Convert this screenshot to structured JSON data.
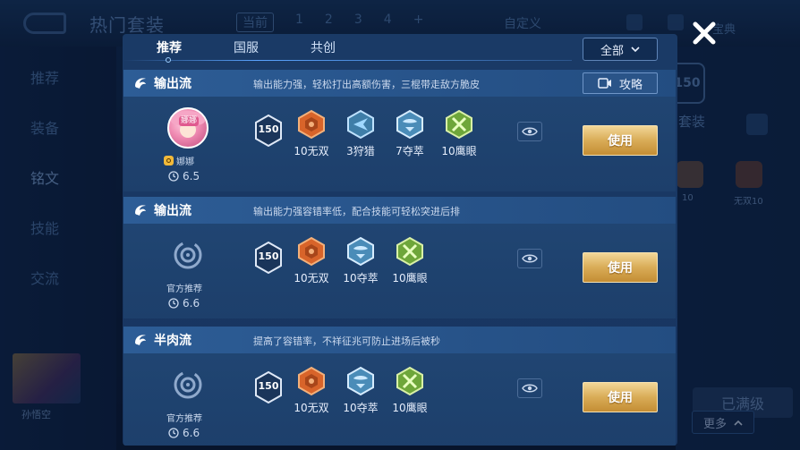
{
  "background": {
    "page_title": "热门套装",
    "top_tabs": [
      "当前",
      "1",
      "2",
      "3",
      "4",
      "+"
    ],
    "custom_label": "自定义",
    "fav_label": "宝典",
    "sidebar": [
      "推荐",
      "装备",
      "铭文",
      "技能",
      "交流"
    ],
    "hero_name": "孙悟空",
    "right_panel": {
      "level": "150",
      "title": "热门套装",
      "rune_labels": [
        "10",
        "无双10"
      ],
      "full_label": "已满级",
      "more_label": "更多"
    }
  },
  "modal": {
    "tabs": [
      "推荐",
      "国服",
      "共创"
    ],
    "active_tab": "推荐",
    "filter_label": "全部",
    "cards": [
      {
        "style": "输出流",
        "desc": "输出能力强，轻松打出高额伤害，三棍带走敌方脆皮",
        "guide_label": "攻略",
        "author": {
          "type": "player",
          "name": "娜娜",
          "avatar_badge": "娜娜",
          "rating": "6.5"
        },
        "level": "150",
        "runes": [
          {
            "label": "10无双",
            "color": "red"
          },
          {
            "label": "3狩猎",
            "color": "blue"
          },
          {
            "label": "7夺萃",
            "color": "blue"
          },
          {
            "label": "10鹰眼",
            "color": "green"
          }
        ],
        "use_label": "使用"
      },
      {
        "style": "输出流",
        "desc": "输出能力强容错率低，配合技能可轻松突进后排",
        "author": {
          "type": "official",
          "name": "官方推荐",
          "rating": "6.6"
        },
        "level": "150",
        "runes": [
          {
            "label": "10无双",
            "color": "red"
          },
          {
            "label": "10夺萃",
            "color": "blue"
          },
          {
            "label": "10鹰眼",
            "color": "green"
          }
        ],
        "use_label": "使用"
      },
      {
        "style": "半肉流",
        "desc": "提高了容错率，不祥征兆可防止进场后被秒",
        "author": {
          "type": "official",
          "name": "官方推荐",
          "rating": "6.6"
        },
        "level": "150",
        "runes": [
          {
            "label": "10无双",
            "color": "red"
          },
          {
            "label": "10夺萃",
            "color": "blue"
          },
          {
            "label": "10鹰眼",
            "color": "green"
          }
        ],
        "use_label": "使用"
      }
    ]
  },
  "icons": {
    "close": "close-icon",
    "eye": "eye-icon",
    "video": "video-icon",
    "clock": "clock-icon",
    "chevron": "chevron-down-icon"
  },
  "colors": {
    "gold_button": "#d9ac57",
    "rune_red": "#d8642a",
    "rune_blue": "#5aa6d8",
    "rune_green": "#8fc84a"
  }
}
